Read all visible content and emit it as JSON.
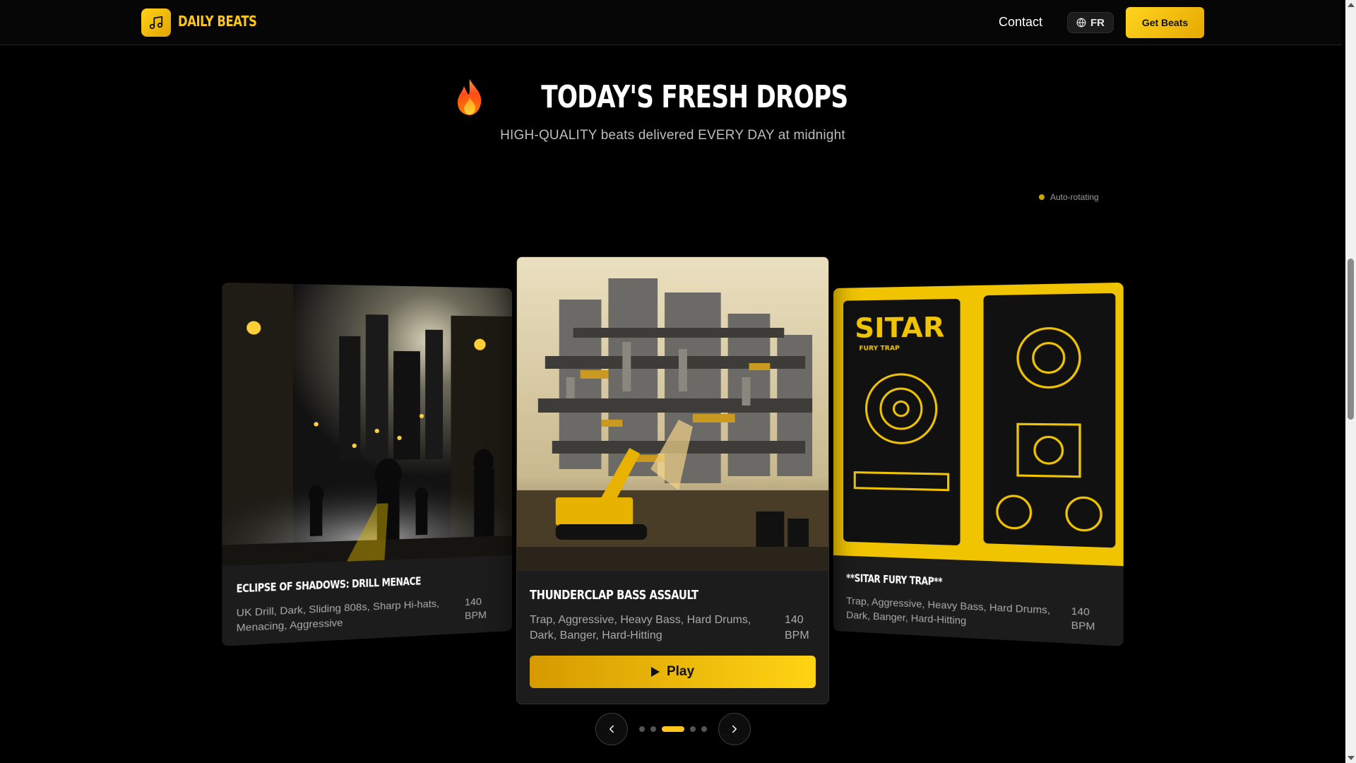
{
  "header": {
    "brand": "DAILY BEATS",
    "logo_icon": "music-note-icon",
    "contact": "Contact",
    "lang_icon": "globe-icon",
    "lang": "FR",
    "cta": "Get Beats"
  },
  "hero": {
    "title": "TODAY'S FRESH DROPS",
    "subtitle": "HIGH-QUALITY beats delivered EVERY DAY at midnight",
    "auto_rotating": "Auto-rotating"
  },
  "carousel": {
    "cards": [
      {
        "title": "ECLIPSE OF SHADOWS: DRILL MENACE",
        "tags": "UK Drill, Dark, Sliding 808s, Sharp Hi-hats, Menacing, Aggressive",
        "bpm": "140 BPM"
      },
      {
        "title": "THUNDERCLAP BASS ASSAULT",
        "tags": "Trap, Aggressive, Heavy Bass, Hard Drums, Dark, Banger, Hard-Hitting",
        "bpm": "140 BPM",
        "play_label": "Play"
      },
      {
        "title": "**SITAR FURY TRAP**",
        "tags": "Trap, Aggressive, Heavy Bass, Hard Drums, Dark, Banger, Hard-Hitting",
        "bpm": "140 BPM",
        "art_text": "SITAR",
        "art_subtext": "FURY TRAP"
      }
    ],
    "active_index": 2,
    "dot_count": 5
  },
  "colors": {
    "accent": "#ffc61a",
    "background": "#000000",
    "card": "#1c1c1c"
  }
}
